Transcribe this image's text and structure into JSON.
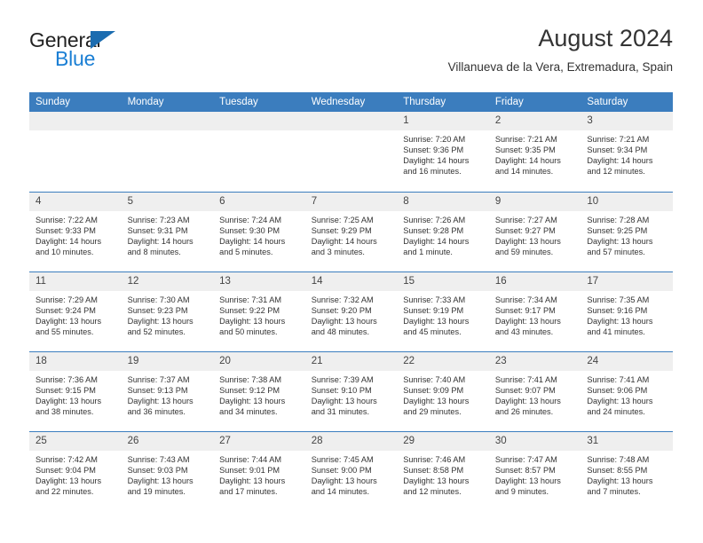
{
  "brand": {
    "name_part1": "General",
    "name_part2": "Blue",
    "triangle_color": "#1b6cb0",
    "blue_color": "#1b7fd4"
  },
  "header": {
    "title": "August 2024",
    "subtitle": "Villanueva de la Vera, Extremadura, Spain",
    "accent_color": "#3b7dbe",
    "daynum_bg": "#efefef"
  },
  "calendar": {
    "weekday_headers": [
      "Sunday",
      "Monday",
      "Tuesday",
      "Wednesday",
      "Thursday",
      "Friday",
      "Saturday"
    ],
    "weeks": [
      [
        {
          "day": "",
          "blank": true
        },
        {
          "day": "",
          "blank": true
        },
        {
          "day": "",
          "blank": true
        },
        {
          "day": "",
          "blank": true
        },
        {
          "day": "1",
          "sunrise": "Sunrise: 7:20 AM",
          "sunset": "Sunset: 9:36 PM",
          "daylight1": "Daylight: 14 hours",
          "daylight2": "and 16 minutes."
        },
        {
          "day": "2",
          "sunrise": "Sunrise: 7:21 AM",
          "sunset": "Sunset: 9:35 PM",
          "daylight1": "Daylight: 14 hours",
          "daylight2": "and 14 minutes."
        },
        {
          "day": "3",
          "sunrise": "Sunrise: 7:21 AM",
          "sunset": "Sunset: 9:34 PM",
          "daylight1": "Daylight: 14 hours",
          "daylight2": "and 12 minutes."
        }
      ],
      [
        {
          "day": "4",
          "sunrise": "Sunrise: 7:22 AM",
          "sunset": "Sunset: 9:33 PM",
          "daylight1": "Daylight: 14 hours",
          "daylight2": "and 10 minutes."
        },
        {
          "day": "5",
          "sunrise": "Sunrise: 7:23 AM",
          "sunset": "Sunset: 9:31 PM",
          "daylight1": "Daylight: 14 hours",
          "daylight2": "and 8 minutes."
        },
        {
          "day": "6",
          "sunrise": "Sunrise: 7:24 AM",
          "sunset": "Sunset: 9:30 PM",
          "daylight1": "Daylight: 14 hours",
          "daylight2": "and 5 minutes."
        },
        {
          "day": "7",
          "sunrise": "Sunrise: 7:25 AM",
          "sunset": "Sunset: 9:29 PM",
          "daylight1": "Daylight: 14 hours",
          "daylight2": "and 3 minutes."
        },
        {
          "day": "8",
          "sunrise": "Sunrise: 7:26 AM",
          "sunset": "Sunset: 9:28 PM",
          "daylight1": "Daylight: 14 hours",
          "daylight2": "and 1 minute."
        },
        {
          "day": "9",
          "sunrise": "Sunrise: 7:27 AM",
          "sunset": "Sunset: 9:27 PM",
          "daylight1": "Daylight: 13 hours",
          "daylight2": "and 59 minutes."
        },
        {
          "day": "10",
          "sunrise": "Sunrise: 7:28 AM",
          "sunset": "Sunset: 9:25 PM",
          "daylight1": "Daylight: 13 hours",
          "daylight2": "and 57 minutes."
        }
      ],
      [
        {
          "day": "11",
          "sunrise": "Sunrise: 7:29 AM",
          "sunset": "Sunset: 9:24 PM",
          "daylight1": "Daylight: 13 hours",
          "daylight2": "and 55 minutes."
        },
        {
          "day": "12",
          "sunrise": "Sunrise: 7:30 AM",
          "sunset": "Sunset: 9:23 PM",
          "daylight1": "Daylight: 13 hours",
          "daylight2": "and 52 minutes."
        },
        {
          "day": "13",
          "sunrise": "Sunrise: 7:31 AM",
          "sunset": "Sunset: 9:22 PM",
          "daylight1": "Daylight: 13 hours",
          "daylight2": "and 50 minutes."
        },
        {
          "day": "14",
          "sunrise": "Sunrise: 7:32 AM",
          "sunset": "Sunset: 9:20 PM",
          "daylight1": "Daylight: 13 hours",
          "daylight2": "and 48 minutes."
        },
        {
          "day": "15",
          "sunrise": "Sunrise: 7:33 AM",
          "sunset": "Sunset: 9:19 PM",
          "daylight1": "Daylight: 13 hours",
          "daylight2": "and 45 minutes."
        },
        {
          "day": "16",
          "sunrise": "Sunrise: 7:34 AM",
          "sunset": "Sunset: 9:17 PM",
          "daylight1": "Daylight: 13 hours",
          "daylight2": "and 43 minutes."
        },
        {
          "day": "17",
          "sunrise": "Sunrise: 7:35 AM",
          "sunset": "Sunset: 9:16 PM",
          "daylight1": "Daylight: 13 hours",
          "daylight2": "and 41 minutes."
        }
      ],
      [
        {
          "day": "18",
          "sunrise": "Sunrise: 7:36 AM",
          "sunset": "Sunset: 9:15 PM",
          "daylight1": "Daylight: 13 hours",
          "daylight2": "and 38 minutes."
        },
        {
          "day": "19",
          "sunrise": "Sunrise: 7:37 AM",
          "sunset": "Sunset: 9:13 PM",
          "daylight1": "Daylight: 13 hours",
          "daylight2": "and 36 minutes."
        },
        {
          "day": "20",
          "sunrise": "Sunrise: 7:38 AM",
          "sunset": "Sunset: 9:12 PM",
          "daylight1": "Daylight: 13 hours",
          "daylight2": "and 34 minutes."
        },
        {
          "day": "21",
          "sunrise": "Sunrise: 7:39 AM",
          "sunset": "Sunset: 9:10 PM",
          "daylight1": "Daylight: 13 hours",
          "daylight2": "and 31 minutes."
        },
        {
          "day": "22",
          "sunrise": "Sunrise: 7:40 AM",
          "sunset": "Sunset: 9:09 PM",
          "daylight1": "Daylight: 13 hours",
          "daylight2": "and 29 minutes."
        },
        {
          "day": "23",
          "sunrise": "Sunrise: 7:41 AM",
          "sunset": "Sunset: 9:07 PM",
          "daylight1": "Daylight: 13 hours",
          "daylight2": "and 26 minutes."
        },
        {
          "day": "24",
          "sunrise": "Sunrise: 7:41 AM",
          "sunset": "Sunset: 9:06 PM",
          "daylight1": "Daylight: 13 hours",
          "daylight2": "and 24 minutes."
        }
      ],
      [
        {
          "day": "25",
          "sunrise": "Sunrise: 7:42 AM",
          "sunset": "Sunset: 9:04 PM",
          "daylight1": "Daylight: 13 hours",
          "daylight2": "and 22 minutes."
        },
        {
          "day": "26",
          "sunrise": "Sunrise: 7:43 AM",
          "sunset": "Sunset: 9:03 PM",
          "daylight1": "Daylight: 13 hours",
          "daylight2": "and 19 minutes."
        },
        {
          "day": "27",
          "sunrise": "Sunrise: 7:44 AM",
          "sunset": "Sunset: 9:01 PM",
          "daylight1": "Daylight: 13 hours",
          "daylight2": "and 17 minutes."
        },
        {
          "day": "28",
          "sunrise": "Sunrise: 7:45 AM",
          "sunset": "Sunset: 9:00 PM",
          "daylight1": "Daylight: 13 hours",
          "daylight2": "and 14 minutes."
        },
        {
          "day": "29",
          "sunrise": "Sunrise: 7:46 AM",
          "sunset": "Sunset: 8:58 PM",
          "daylight1": "Daylight: 13 hours",
          "daylight2": "and 12 minutes."
        },
        {
          "day": "30",
          "sunrise": "Sunrise: 7:47 AM",
          "sunset": "Sunset: 8:57 PM",
          "daylight1": "Daylight: 13 hours",
          "daylight2": "and 9 minutes."
        },
        {
          "day": "31",
          "sunrise": "Sunrise: 7:48 AM",
          "sunset": "Sunset: 8:55 PM",
          "daylight1": "Daylight: 13 hours",
          "daylight2": "and 7 minutes."
        }
      ]
    ]
  }
}
